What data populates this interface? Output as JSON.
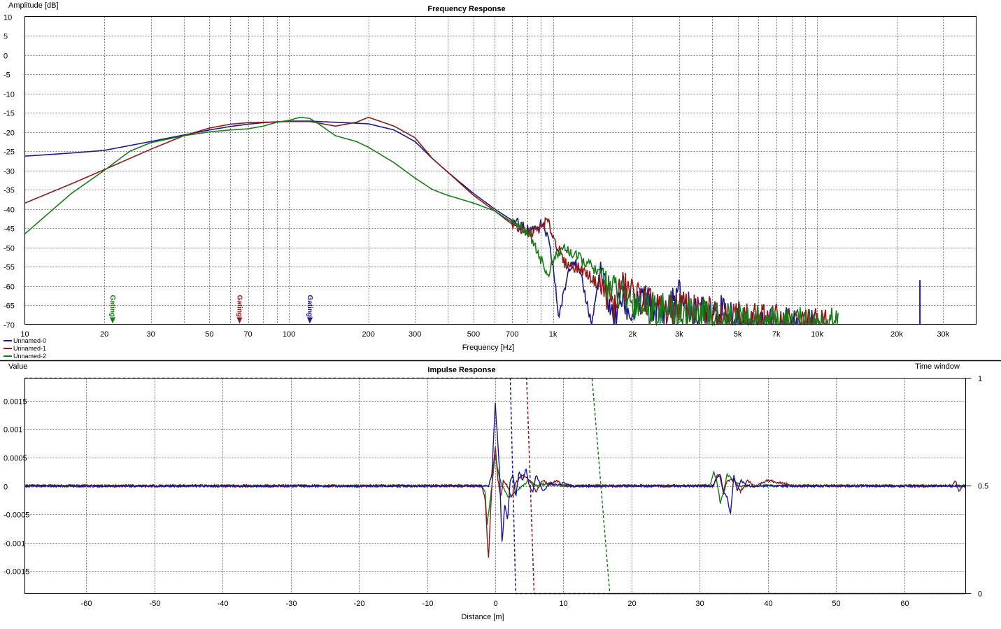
{
  "colors": {
    "series0": "#1a1a8c",
    "series1": "#8b1a1a",
    "series2": "#1a7a1a"
  },
  "chart_data": [
    {
      "type": "line",
      "title": "Frequency Response",
      "ylabel": "Amplitude [dB]",
      "xlabel": "Frequency [Hz]",
      "xscale": "log",
      "xlim": [
        10,
        40000
      ],
      "ylim": [
        -70,
        10
      ],
      "grid": true,
      "x_tick_labels": [
        {
          "v": 10,
          "t": "10"
        },
        {
          "v": 20,
          "t": "20"
        },
        {
          "v": 30,
          "t": "30"
        },
        {
          "v": 50,
          "t": "50"
        },
        {
          "v": 70,
          "t": "70"
        },
        {
          "v": 100,
          "t": "100"
        },
        {
          "v": 200,
          "t": "200"
        },
        {
          "v": 300,
          "t": "300"
        },
        {
          "v": 500,
          "t": "500"
        },
        {
          "v": 700,
          "t": "700"
        },
        {
          "v": 1000,
          "t": "1k"
        },
        {
          "v": 2000,
          "t": "2k"
        },
        {
          "v": 3000,
          "t": "3k"
        },
        {
          "v": 5000,
          "t": "5k"
        },
        {
          "v": 7000,
          "t": "7k"
        },
        {
          "v": 10000,
          "t": "10k"
        },
        {
          "v": 20000,
          "t": "20k"
        },
        {
          "v": 30000,
          "t": "30k"
        }
      ],
      "y_ticks": [
        10,
        5,
        0,
        -5,
        -10,
        -15,
        -20,
        -25,
        -30,
        -35,
        -40,
        -45,
        -50,
        -55,
        -60,
        -65,
        -70
      ],
      "legend": {
        "placement": "bottom-left",
        "entries": [
          "Unnamed-0",
          "Unnamed-1",
          "Unnamed-2"
        ]
      },
      "gating_markers": [
        {
          "label": "Gating",
          "x": 21.5,
          "series": 2
        },
        {
          "label": "Gating",
          "x": 65,
          "series": 1
        },
        {
          "label": "Gating",
          "x": 120,
          "series": 0
        }
      ],
      "series": [
        {
          "name": "Unnamed-0",
          "x": [
            10,
            15,
            20,
            30,
            40,
            50,
            60,
            70,
            80,
            100,
            120,
            150,
            200,
            250,
            300,
            350,
            400,
            500,
            600,
            700,
            800,
            850,
            900,
            950,
            1000,
            1050,
            1100,
            1150,
            1200,
            1300,
            1400,
            1500,
            1600,
            1700,
            1800,
            2000,
            2200,
            2500,
            2800,
            3000,
            3500,
            4000,
            5000,
            6000,
            7000,
            8000,
            9000,
            10000
          ],
          "y": [
            -26.3,
            -25.5,
            -24.8,
            -22.5,
            -20.8,
            -19.5,
            -18.6,
            -18.0,
            -17.6,
            -17.2,
            -17.2,
            -17.5,
            -17.9,
            -19.5,
            -22.5,
            -27.0,
            -30.5,
            -36.0,
            -40.0,
            -43.0,
            -45.5,
            -45.0,
            -44.0,
            -47.0,
            -55.0,
            -68.0,
            -62.0,
            -55.0,
            -53.0,
            -60.0,
            -70.0,
            -57.0,
            -62.0,
            -70.0,
            -63.0,
            -68.0,
            -63.0,
            -68.0,
            -65.0,
            -62.0,
            -68.0,
            -65.0,
            -70.0,
            -70.0,
            -70.0,
            -70.0,
            -70.0,
            -70.0
          ]
        },
        {
          "name": "Unnamed-1",
          "x": [
            10,
            15,
            20,
            30,
            40,
            50,
            60,
            70,
            80,
            100,
            120,
            150,
            180,
            200,
            250,
            300,
            350,
            400,
            500,
            600,
            700,
            800,
            900,
            950,
            1000,
            1100,
            1200,
            1300,
            1400,
            1500,
            1600,
            1700,
            1800,
            2000,
            2200,
            2500,
            2800,
            3000,
            3500,
            4000,
            5000,
            6000,
            7000,
            8000,
            9000,
            10000,
            11000
          ],
          "y": [
            -38.5,
            -33.5,
            -29.8,
            -24.5,
            -21.0,
            -19.0,
            -18.0,
            -17.6,
            -17.5,
            -17.3,
            -17.3,
            -18.5,
            -17.5,
            -16.2,
            -18.5,
            -21.5,
            -27.0,
            -30.5,
            -36.5,
            -40.5,
            -44.0,
            -46.5,
            -45.0,
            -43.0,
            -47.0,
            -54.0,
            -55.0,
            -56.0,
            -58.0,
            -60.0,
            -62.0,
            -66.0,
            -60.0,
            -62.0,
            -64.0,
            -66.0,
            -67.0,
            -65.0,
            -67.0,
            -66.0,
            -68.0,
            -69.0,
            -69.0,
            -70.0,
            -70.0,
            -70.0,
            -70.0
          ]
        },
        {
          "name": "Unnamed-2",
          "x": [
            10,
            15,
            20,
            25,
            30,
            40,
            50,
            60,
            70,
            80,
            90,
            100,
            110,
            120,
            130,
            150,
            180,
            200,
            250,
            300,
            350,
            400,
            500,
            600,
            700,
            750,
            800,
            850,
            900,
            950,
            1000,
            1100,
            1200,
            1300,
            1400,
            1500,
            1600,
            1700,
            1800,
            2000,
            2200,
            2500,
            3000,
            3500,
            4000,
            5000,
            6000,
            7000,
            8000,
            9000,
            10000,
            12000
          ],
          "y": [
            -46.5,
            -36.0,
            -30.0,
            -25.0,
            -22.8,
            -21.0,
            -20.0,
            -19.5,
            -19.2,
            -18.5,
            -17.5,
            -17.0,
            -16.2,
            -16.5,
            -18.0,
            -21.0,
            -22.5,
            -24.0,
            -28.0,
            -32.0,
            -35.0,
            -36.5,
            -38.5,
            -40.5,
            -43.5,
            -44.5,
            -46.0,
            -49.0,
            -53.0,
            -57.5,
            -53.5,
            -50.0,
            -52.0,
            -53.5,
            -55.0,
            -57.0,
            -59.0,
            -61.0,
            -63.0,
            -64.0,
            -65.0,
            -66.0,
            -67.0,
            -68.0,
            -68.5,
            -69.0,
            -69.5,
            -70.0,
            -70.0,
            -70.0,
            -70.0,
            -70.0
          ]
        }
      ],
      "spike": {
        "series": 0,
        "x": 24500,
        "y": -58.5
      }
    },
    {
      "type": "line",
      "title": "Impulse Response",
      "ylabel": "Value",
      "xlabel": "Distance [m]",
      "right_axis_label": "Time window",
      "xlim": [
        -69,
        69
      ],
      "ylim": [
        -0.0019,
        0.0019
      ],
      "right_ylim": [
        0,
        1
      ],
      "grid": true,
      "x_ticks": [
        -60,
        -50,
        -40,
        -30,
        -20,
        -10,
        0,
        10,
        20,
        30,
        40,
        50,
        60
      ],
      "y_tick_labels": [
        {
          "v": 0.0015,
          "t": "0.0015"
        },
        {
          "v": 0.001,
          "t": "0.001"
        },
        {
          "v": 0.0005,
          "t": "0.0005"
        },
        {
          "v": 0,
          "t": "0"
        },
        {
          "v": -0.0005,
          "t": "-0.0005"
        },
        {
          "v": -0.001,
          "t": "-0.001"
        },
        {
          "v": -0.0015,
          "t": "-0.0015"
        }
      ],
      "right_tick_labels": [
        {
          "v": 1,
          "t": "1"
        },
        {
          "v": 0.5,
          "t": "0.5"
        },
        {
          "v": 0,
          "t": "0"
        }
      ],
      "series": [
        {
          "name": "Unnamed-0",
          "x": [
            -1.0,
            -0.5,
            0,
            0.3,
            0.6,
            1.0,
            1.4,
            1.8,
            2.2,
            2.6,
            3.0,
            3.5,
            4.0,
            4.5,
            5.0,
            5.5,
            6.0,
            7.0,
            8.0,
            9.0,
            10.0,
            11.0,
            12.0,
            32.0,
            32.5,
            33.0,
            33.5,
            34.0,
            34.5,
            35.0,
            35.5,
            36.0,
            37.0,
            38.0,
            68.0
          ],
          "y": [
            0.0,
            0.0002,
            0.00145,
            0.0009,
            0.0003,
            -0.00105,
            -0.0003,
            -0.0006,
            0.0001,
            0.0002,
            -0.0002,
            0.00025,
            0.0001,
            0.0003,
            0.0,
            -0.0001,
            0.0002,
            -0.0001,
            5e-05,
            0.0,
            5e-05,
            0.0,
            0.0,
            0.0,
            0.00015,
            0.0002,
            -0.0001,
            -0.0002,
            -0.0005,
            0.0002,
            -0.0001,
            0.0001,
            0.0,
            0.0,
            0.0
          ]
        },
        {
          "name": "Unnamed-1",
          "x": [
            -2.0,
            -1.5,
            -1.0,
            -0.7,
            -0.4,
            0,
            0.4,
            0.8,
            1.2,
            1.8,
            2.4,
            3.0,
            4.0,
            5.0,
            6.0,
            7.0,
            8.0,
            9.0,
            10.0,
            12.0,
            32.0,
            32.5,
            33.0,
            33.5,
            34.0,
            35.0,
            36.0,
            37.0,
            38.0,
            40.0,
            44.0,
            67.0,
            67.5,
            68.0,
            68.5
          ],
          "y": [
            0.0,
            -0.0002,
            -0.0013,
            -0.0005,
            0.0002,
            0.0007,
            0.0001,
            -0.0002,
            0.0001,
            0.0,
            -0.0002,
            5e-05,
            0.0002,
            0.0001,
            -0.0001,
            0.0001,
            0.0,
            0.0001,
            0.0,
            0.0,
            0.0,
            0.0002,
            0.00015,
            -0.00015,
            0.0001,
            0.0001,
            -0.0001,
            0.0001,
            0.0,
            0.0001,
            0.0,
            0.0,
            0.0001,
            -0.0001,
            0.0
          ]
        },
        {
          "name": "Unnamed-2",
          "x": [
            -2.0,
            -1.5,
            -1.2,
            -0.8,
            -0.4,
            0,
            0.5,
            1.0,
            1.5,
            2.0,
            2.5,
            3.0,
            4.0,
            5.0,
            6.0,
            8.0,
            10.0,
            12.0,
            31.5,
            32.0,
            32.5,
            33.0,
            33.5,
            34.0,
            35.0,
            36.0,
            38.0,
            67.0,
            68.0
          ],
          "y": [
            0.0,
            -0.0001,
            -0.0007,
            -0.0003,
            0.0001,
            0.00055,
            0.0002,
            0.0,
            -0.0001,
            -0.0002,
            -0.00015,
            -0.0001,
            0.0,
            0.0001,
            0.0,
            5e-05,
            0.0,
            0.0,
            0.0,
            0.00025,
            0.0001,
            -0.0003,
            -0.0001,
            0.0002,
            0.0001,
            0.0,
            0.0,
            0.0,
            0.0
          ]
        }
      ],
      "time_windows": [
        {
          "series": 0,
          "start": -69,
          "fall_start": 2.2,
          "fall_end": 3.0
        },
        {
          "series": 1,
          "start": 2.3,
          "fall_start": 4.6,
          "fall_end": 5.7
        },
        {
          "series": 2,
          "start": 4.2,
          "fall_start": 14.2,
          "fall_end": 16.8
        }
      ]
    }
  ]
}
